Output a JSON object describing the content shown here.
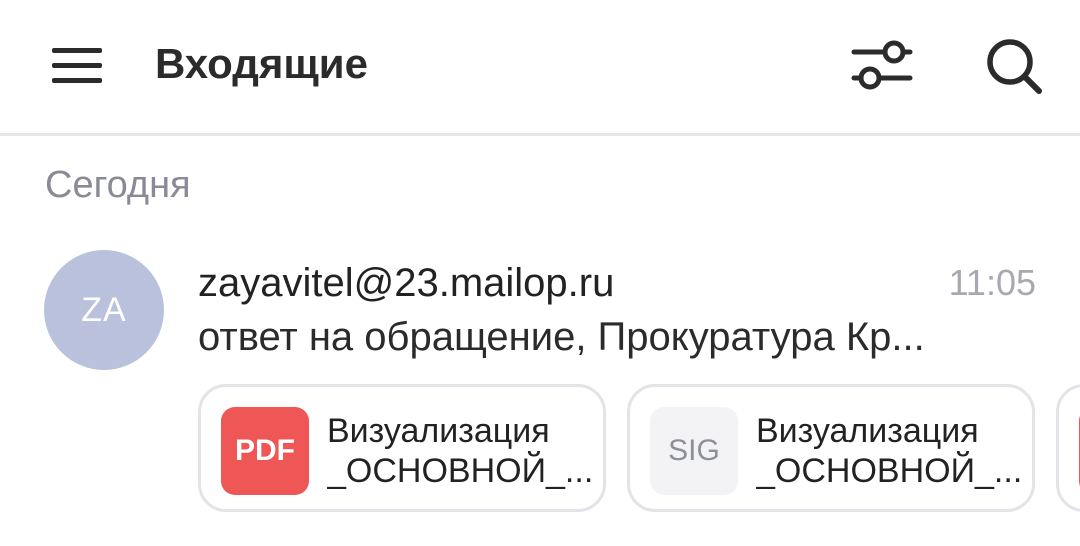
{
  "header": {
    "title": "Входящие",
    "menu_icon": "hamburger-menu-icon",
    "filter_icon": "filter-sliders-icon",
    "search_icon": "search-icon"
  },
  "section": {
    "label": "Сегодня"
  },
  "messages": [
    {
      "avatar_initials": "ZA",
      "avatar_color": "#b9c1dc",
      "sender": "zayavitel@23.mailop.ru",
      "time": "11:05",
      "subject": "ответ на обращение, Прокуратура Кр...",
      "attachments": [
        {
          "type_label": "PDF",
          "icon_color": "#ef5757",
          "name_line1": "Визуализация",
          "name_line2": "_ОСНОВНОЙ_..."
        },
        {
          "type_label": "SIG",
          "icon_color": "#f3f3f5",
          "name_line1": "Визуализация",
          "name_line2": "_ОСНОВНОЙ_..."
        },
        {
          "type_label": "",
          "icon_color": "#ef5757",
          "name_line1": "",
          "name_line2": ""
        }
      ]
    }
  ],
  "colors": {
    "accent_pdf": "#ef5757",
    "muted_text": "#8a8a96",
    "divider": "#e6e6e8"
  }
}
